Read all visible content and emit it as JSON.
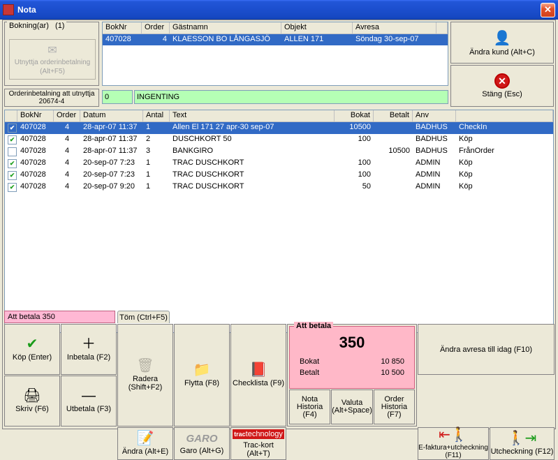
{
  "title": "Nota",
  "bokningar": {
    "label": "Bokning(ar)",
    "count": "(1)"
  },
  "order_btn": {
    "l1": "Utnyttja orderinbetalning",
    "l2": "(Alt+F5)"
  },
  "guest_hdr": {
    "boknr": "BokNr",
    "order": "Order",
    "namn": "Gästnamn",
    "objekt": "Objekt",
    "avresa": "Avresa"
  },
  "guest_row": {
    "boknr": "407028",
    "order": "4",
    "namn": "KLAESSON BO LÅNGASJÖ",
    "objekt": "ALLEN 171",
    "avresa": "Söndag 30-sep-07"
  },
  "andra_kund": "Ändra kund (Alt+C)",
  "stang": "Stäng (Esc)",
  "orderin_label": "Orderinbetalning att utnyttja 20674-4",
  "green0": "0",
  "green1": "INGENTING",
  "lhdr": {
    "boknr": "BokNr",
    "order": "Order",
    "datum": "Datum",
    "antal": "Antal",
    "text": "Text",
    "bokat": "Bokat",
    "betalt": "Betalt",
    "anv": "Anv"
  },
  "rows": [
    {
      "chk": true,
      "boknr": "407028",
      "order": "4",
      "datum": "28-apr-07 11:37",
      "antal": "1",
      "text": "Allen El 171   27 apr-30 sep-07",
      "bokat": "10500",
      "betalt": "",
      "anv": "BADHUS",
      "extra": "CheckIn"
    },
    {
      "chk": true,
      "boknr": "407028",
      "order": "4",
      "datum": "28-apr-07 11:37",
      "antal": "2",
      "text": "DUSCHKORT 50",
      "bokat": "100",
      "betalt": "",
      "anv": "BADHUS",
      "extra": "Köp"
    },
    {
      "chk": false,
      "boknr": "407028",
      "order": "4",
      "datum": "28-apr-07 11:37",
      "antal": "3",
      "text": "BANKGIRO",
      "bokat": "",
      "betalt": "10500",
      "anv": "BADHUS",
      "extra": "FrånOrder"
    },
    {
      "chk": true,
      "boknr": "407028",
      "order": "4",
      "datum": "20-sep-07 7:23",
      "antal": "1",
      "text": "TRAC DUSCHKORT",
      "bokat": "100",
      "betalt": "",
      "anv": "ADMIN",
      "extra": "Köp"
    },
    {
      "chk": true,
      "boknr": "407028",
      "order": "4",
      "datum": "20-sep-07 7:23",
      "antal": "1",
      "text": "TRAC DUSCHKORT",
      "bokat": "100",
      "betalt": "",
      "anv": "ADMIN",
      "extra": "Köp"
    },
    {
      "chk": true,
      "boknr": "407028",
      "order": "4",
      "datum": "20-sep-07 9:20",
      "antal": "1",
      "text": "TRAC DUSCHKORT",
      "bokat": "50",
      "betalt": "",
      "anv": "ADMIN",
      "extra": "Köp"
    }
  ],
  "attline": "Att betala 350",
  "tom": "Töm (Ctrl+F5)",
  "btns": {
    "kop": "Köp (Enter)",
    "inbetala": "Inbetala (F2)",
    "radera": "Radera (Shift+F2)",
    "flytta": "Flytta (F8)",
    "checklista": "Checklista (F9)",
    "skriv": "Skriv (F6)",
    "utbetala": "Utbetala (F3)",
    "andra": "Ändra (Alt+E)",
    "garo": "Garo (Alt+G)",
    "trac": "Trac-kort (Alt+T)",
    "andra_avresa": "Ändra avresa till idag (F10)",
    "efakt": "E-faktura+utcheckning (F11)",
    "utcheck": "Utcheckning (F12)",
    "nota": "Nota Historia (F4)",
    "valuta": "Valuta (Alt+Space)",
    "orderhist": "Order Historia (F7)"
  },
  "attbox": {
    "title": "Att betala",
    "total": "350",
    "bokat_l": "Bokat",
    "bokat_v": "10 850",
    "betalt_l": "Betalt",
    "betalt_v": "10 500"
  }
}
